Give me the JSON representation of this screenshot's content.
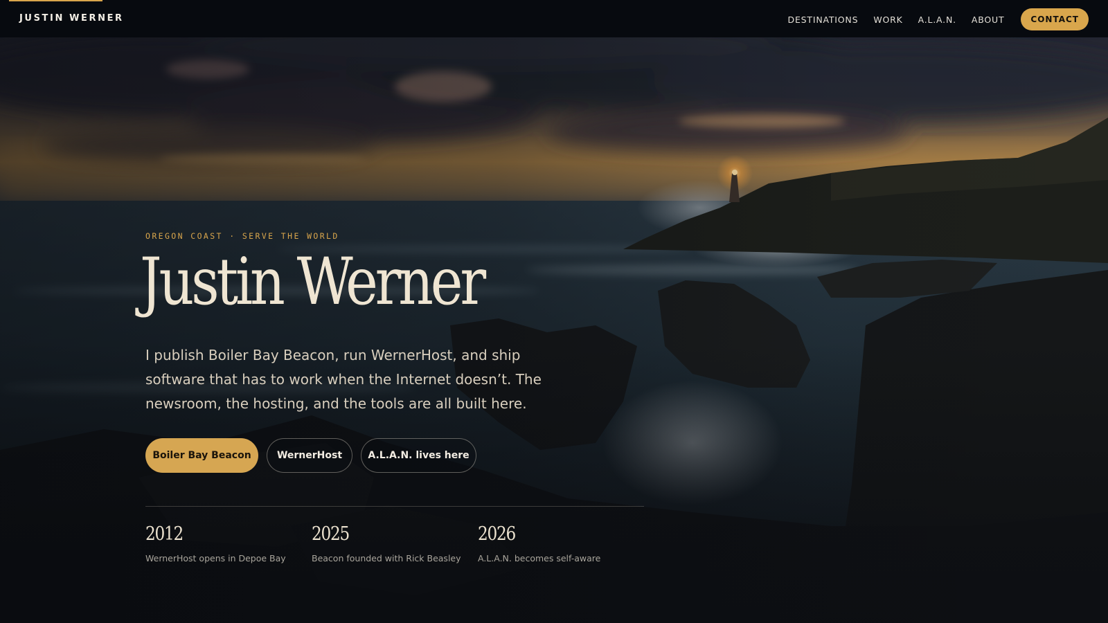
{
  "brand": {
    "name": "JUSTIN WERNER",
    "accent_color": "#d9a64c"
  },
  "nav": {
    "links": [
      "DESTINATIONS",
      "WORK",
      "A.L.A.N.",
      "ABOUT"
    ],
    "contact_label": "CONTACT"
  },
  "hero": {
    "kicker": "OREGON COAST · SERVE THE WORLD",
    "title": "Justin Werner",
    "lede": "I publish Boiler Bay Beacon, run WernerHost, and ship software that has to work when the Internet doesn’t. The newsroom, the hosting, and the tools are all built here.",
    "buttons": {
      "primary": "Boiler Bay Beacon",
      "secondary": "WernerHost",
      "tertiary": "A.L.A.N. lives here"
    },
    "background": "lighthouse-on-rocky-coast-at-dusk"
  },
  "milestones": [
    {
      "year": "2012",
      "note": "WernerHost opens in Depoe Bay"
    },
    {
      "year": "2025",
      "note": "Beacon founded with Rick Beasley"
    },
    {
      "year": "2026",
      "note": "A.L.A.N. becomes self-aware"
    }
  ]
}
